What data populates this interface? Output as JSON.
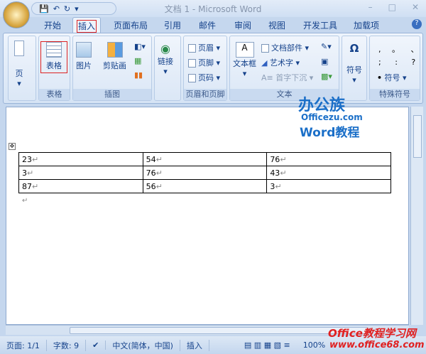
{
  "window": {
    "title": "文档 1 - Microsoft Word",
    "minimize": "–",
    "maximize": "□",
    "close": "✕"
  },
  "qat": {
    "save": "💾",
    "undo": "↶",
    "redo": "↻",
    "more": "▾"
  },
  "tabs": [
    "开始",
    "插入",
    "页面布局",
    "引用",
    "邮件",
    "审阅",
    "视图",
    "开发工具",
    "加载项"
  ],
  "help": "?",
  "ribbon": {
    "page": {
      "label": "页"
    },
    "table": {
      "button": "表格",
      "group": "表格"
    },
    "illus": {
      "picture": "图片",
      "clipart": "剪贴画",
      "group": "插图"
    },
    "links": {
      "button": "链接"
    },
    "header": {
      "header": "页眉",
      "footer": "页脚",
      "pagenum": "页码",
      "group": "页眉和页脚"
    },
    "text": {
      "textbox": "文本框",
      "parts": "文档部件",
      "wordart": "艺术字",
      "dropcap": "首字下沉",
      "group": "文本"
    },
    "symbol": {
      "button": "符号",
      "group": ""
    },
    "special": {
      "row1": ", 。 、",
      "row2": "; : ?",
      "symbol": "符号",
      "group": "特殊符号"
    }
  },
  "table": [
    [
      "23",
      "54",
      "76"
    ],
    [
      "3",
      "76",
      "43"
    ],
    [
      "87",
      "56",
      "3"
    ]
  ],
  "mark": "↵",
  "status": {
    "page": "页面: 1/1",
    "words": "字数: 9",
    "lang": "中文(简体，中国)",
    "mode": "插入",
    "zoom": "100%"
  },
  "watermarks": {
    "brand": "办公族",
    "site": "Officezu.com",
    "word": "Word教程",
    "office": "Office教程学习网",
    "url": "www.office68.com"
  }
}
